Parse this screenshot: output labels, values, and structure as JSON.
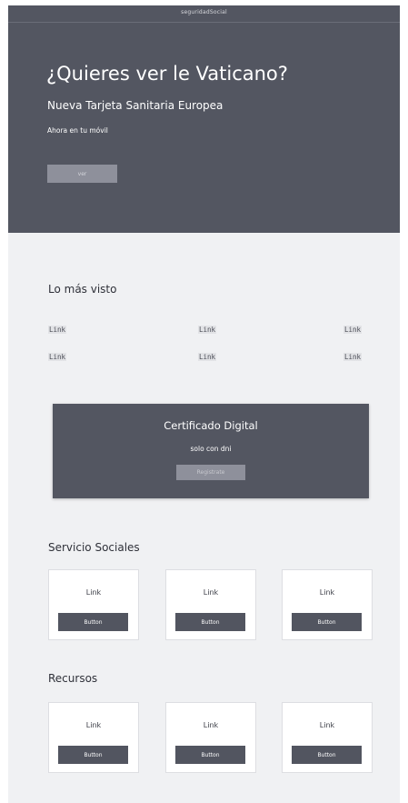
{
  "header": {
    "site_name": "seguridadSocial"
  },
  "hero": {
    "title": "¿Quieres ver le Vaticano?",
    "subtitle": "Nueva Tarjeta Sanitaria Europea",
    "text": "Ahora en tu móvil",
    "button_label": "ver"
  },
  "most_viewed": {
    "title": "Lo más visto",
    "links": [
      "Link",
      "Link",
      "Link",
      "Link",
      "Link",
      "Link"
    ]
  },
  "certificate": {
    "title": "Certificado Digital",
    "text": "solo con dni",
    "button_label": "Registrate"
  },
  "social_services": {
    "title": "Servicio Sociales",
    "cards": [
      {
        "link": "Link",
        "button": "Button"
      },
      {
        "link": "Link",
        "button": "Button"
      },
      {
        "link": "Link",
        "button": "Button"
      }
    ]
  },
  "resources": {
    "title": "Recursos",
    "cards": [
      {
        "link": "Link",
        "button": "Button"
      },
      {
        "link": "Link",
        "button": "Button"
      },
      {
        "link": "Link",
        "button": "Button"
      }
    ]
  },
  "colors": {
    "hero_bg": "#535661",
    "page_bg": "#f0f1f3",
    "muted_button": "#8e909b",
    "card_button": "#525560"
  }
}
